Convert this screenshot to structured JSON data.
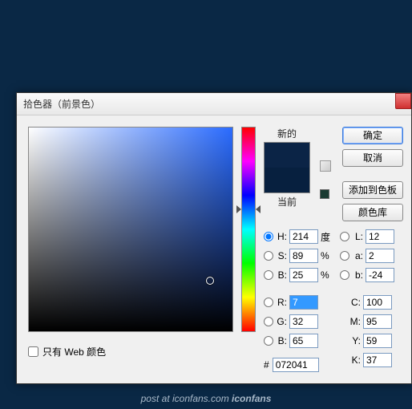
{
  "title": "拾色器（前景色）",
  "swatch": {
    "new_label": "新的",
    "current_label": "当前",
    "new_color": "#0b2446",
    "current_color": "#07203f"
  },
  "buttons": {
    "ok": "确定",
    "cancel": "取消",
    "add_swatch": "添加到色板",
    "library": "颜色库"
  },
  "hsb": {
    "h": {
      "label": "H:",
      "value": "214",
      "unit": "度"
    },
    "s": {
      "label": "S:",
      "value": "89",
      "unit": "%"
    },
    "b": {
      "label": "B:",
      "value": "25",
      "unit": "%"
    }
  },
  "rgb": {
    "r": {
      "label": "R:",
      "value": "7"
    },
    "g": {
      "label": "G:",
      "value": "32"
    },
    "b": {
      "label": "B:",
      "value": "65"
    }
  },
  "lab": {
    "l": {
      "label": "L:",
      "value": "12"
    },
    "a": {
      "label": "a:",
      "value": "2"
    },
    "b": {
      "label": "b:",
      "value": "-24"
    }
  },
  "cmyk": {
    "c": {
      "label": "C:",
      "value": "100"
    },
    "m": {
      "label": "M:",
      "value": "95"
    },
    "y": {
      "label": "Y:",
      "value": "59"
    },
    "k": {
      "label": "K:",
      "value": "37"
    }
  },
  "hex": {
    "prefix": "#",
    "value": "072041"
  },
  "web_only": "只有 Web 颜色",
  "footer": {
    "pre": "post at ",
    "site": "iconfans.com ",
    "brand": "iconfans"
  }
}
